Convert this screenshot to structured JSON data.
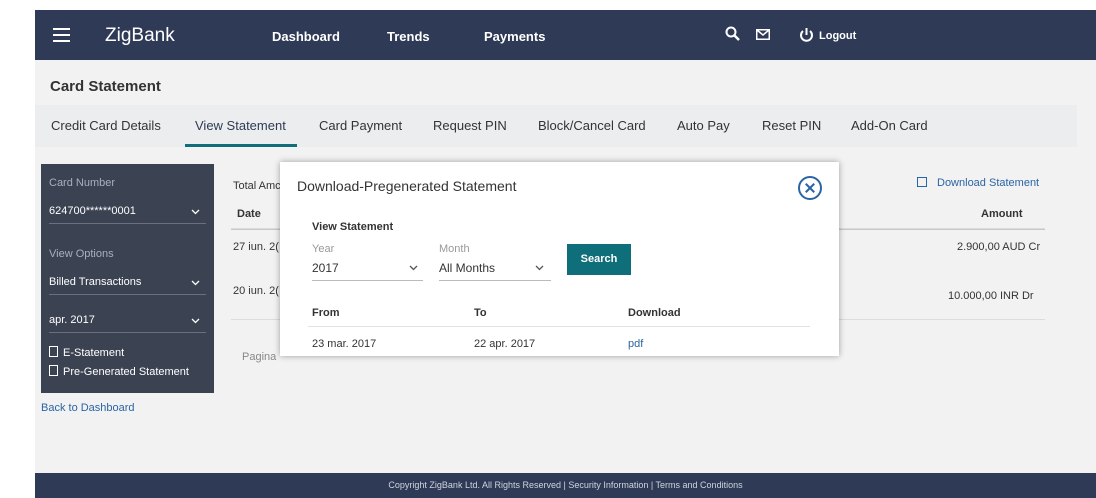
{
  "header": {
    "brand": "ZigBank",
    "nav": [
      "Dashboard",
      "Trends",
      "Payments"
    ],
    "logout": "Logout"
  },
  "page": {
    "title": "Card Statement"
  },
  "tabs": [
    {
      "label": "Credit Card Details"
    },
    {
      "label": "View Statement"
    },
    {
      "label": "Card Payment"
    },
    {
      "label": "Request PIN"
    },
    {
      "label": "Block/Cancel Card"
    },
    {
      "label": "Auto Pay"
    },
    {
      "label": "Reset PIN"
    },
    {
      "label": "Add-On Card"
    }
  ],
  "sidebar": {
    "card_number_label": "Card Number",
    "card_number_value": "624700******0001",
    "view_options_label": "View Options",
    "view_option_value": "Billed Transactions",
    "month_value": "apr. 2017",
    "e_statement": "E-Statement",
    "pre_generated": "Pre-Generated Statement",
    "back": "Back to Dashboard"
  },
  "main": {
    "total_label": "Total Amc",
    "download_statement": "Download Statement",
    "col_date": "Date",
    "col_amount": "Amount",
    "rows": [
      {
        "date": "27 iun. 2(",
        "amount": "2.900,00 AUD Cr"
      },
      {
        "date": "20 iun. 2(",
        "amount": "10.000,00 INR Dr"
      }
    ],
    "pagination_label": "Pagina"
  },
  "modal": {
    "title": "Download-Pregenerated Statement",
    "section": "View Statement",
    "year_label": "Year",
    "year_value": "2017",
    "month_label": "Month",
    "month_value": "All Months",
    "search": "Search",
    "col_from": "From",
    "col_to": "To",
    "col_download": "Download",
    "row": {
      "from": "23 mar. 2017",
      "to": "22 apr. 2017",
      "download": "pdf"
    }
  },
  "footer": {
    "text": "Copyright ZigBank Ltd. All Rights Reserved | Security Information | Terms and Conditions"
  },
  "colors": {
    "header": "#2f3a56",
    "accent": "#0e6e7a",
    "link": "#2a64a4",
    "sidebar": "#3b4252"
  }
}
